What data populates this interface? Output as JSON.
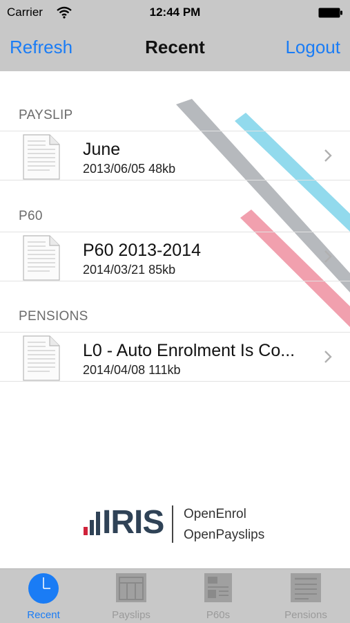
{
  "status_bar": {
    "carrier": "Carrier",
    "time": "12:44 PM"
  },
  "nav": {
    "left_button": "Refresh",
    "title": "Recent",
    "right_button": "Logout"
  },
  "sections": [
    {
      "header": "PAYSLIP",
      "items": [
        {
          "title": "June",
          "subtitle": "2013/06/05 48kb"
        }
      ]
    },
    {
      "header": "P60",
      "items": [
        {
          "title": "P60 2013-2014",
          "subtitle": "2014/03/21 85kb"
        }
      ]
    },
    {
      "header": "PENSIONS",
      "items": [
        {
          "title": "L0 - Auto Enrolment Is Co...",
          "subtitle": "2014/04/08 111kb"
        }
      ]
    }
  ],
  "logo": {
    "brand": "IRIS",
    "line1": "OpenEnrol",
    "line2": "OpenPayslips"
  },
  "tabs": [
    {
      "label": "Recent",
      "icon": "clock-icon",
      "active": true
    },
    {
      "label": "Payslips",
      "icon": "payslip-icon",
      "active": false
    },
    {
      "label": "P60s",
      "icon": "p60-icon",
      "active": false
    },
    {
      "label": "Pensions",
      "icon": "pensions-icon",
      "active": false
    }
  ],
  "colors": {
    "accent": "#1a7cf5",
    "bar_bg": "#c8c8c8",
    "stripe_gray": "#a9adb1",
    "stripe_blue": "#7fd3ea",
    "stripe_pink": "#ee8fa0",
    "brand_dark": "#2f4256",
    "brand_red": "#d0223a"
  }
}
